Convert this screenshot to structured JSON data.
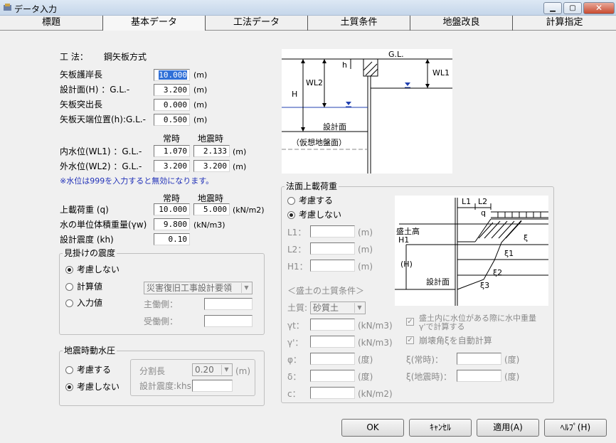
{
  "window": {
    "title": "データ入力"
  },
  "tabs": [
    "標題",
    "基本データ",
    "工法データ",
    "土質条件",
    "地盤改良",
    "計算指定"
  ],
  "method": {
    "label": "工 法：",
    "value": "鋼矢板方式"
  },
  "basic": {
    "rows": [
      {
        "label": "矢板護岸長",
        "value": "10.000",
        "unit": "(m)"
      },
      {
        "label": "設計面(H)  ：G.L.-",
        "value": "3.200",
        "unit": "(m)"
      },
      {
        "label": "矢板突出長",
        "value": "0.000",
        "unit": "(m)"
      },
      {
        "label": "矢板天端位置(h):G.L.-",
        "value": "0.500",
        "unit": "(m)"
      }
    ]
  },
  "water": {
    "col_normal": "常時",
    "col_quake": "地震時",
    "unit": "(m)",
    "inner": {
      "label": "内水位(WL1)  ：G.L.-",
      "normal": "1.070",
      "quake": "2.133"
    },
    "outer": {
      "label": "外水位(WL2)  ：G.L.-",
      "normal": "3.200",
      "quake": "3.200"
    },
    "note": "※水位は999を入力すると無効になります。"
  },
  "load": {
    "col_normal": "常時",
    "col_quake": "地震時",
    "surcharge": {
      "label": "上載荷重 (q)",
      "normal": "10.000",
      "quake": "5.000",
      "unit": "(kN/m2)"
    },
    "unit_weight": {
      "label": "水の単位体積重量(γw)",
      "value": "9.800",
      "unit": "(kN/m3)"
    },
    "seismic": {
      "label": "設計震度 (kh)",
      "value": "0.10"
    }
  },
  "apparent": {
    "title": "見掛けの震度",
    "opt_none": "考慮しない",
    "opt_calc": "計算値",
    "opt_input": "入力値",
    "combo": "災害復旧工事設計要領",
    "main_label": "主働側：",
    "passive_label": "受働側："
  },
  "dynamic": {
    "title": "地震時動水圧",
    "opt_yes": "考慮する",
    "opt_no": "考慮しない",
    "split_label": "分割長",
    "split_value": "0.20",
    "split_unit": "(m)",
    "kh_label": "設計震度:khs"
  },
  "diagram1": {
    "gl": "G.L.",
    "h": "h",
    "wl1": "WL1",
    "wl2": "WL2",
    "H": "H",
    "design": "設計面",
    "virtual": "（仮想地盤面）"
  },
  "slope": {
    "title": "法面上載荷重",
    "opt_yes": "考慮する",
    "opt_no": "考慮しない",
    "L1": "L1：",
    "L2": "L2：",
    "H1": "H1：",
    "unit_m": "(m)",
    "soil_title": "＜盛土の土質条件＞",
    "soil_label": "土質:",
    "soil_value": "砂質土",
    "gt": "γt：",
    "gp": "γ'：",
    "phi": "φ：",
    "delta": "δ：",
    "c": "c：",
    "u_kn3": "(kN/m3)",
    "u_deg": "(度)",
    "u_kn2": "(kN/m2)",
    "chk1": "盛土内に水位がある際に水中重量γ'で計算する",
    "chk2": "崩壊角ξを自動計算",
    "xi_n": "ξ(常時)：",
    "xi_q": "ξ(地震時)："
  },
  "diagram2": {
    "L1": "L1",
    "L2": "L2",
    "q": "q",
    "fill_height": "盛土高",
    "H1": "H1",
    "H": "(H)",
    "design": "設計面",
    "xi": "ξ",
    "xi1": "ξ1",
    "xi2": "ξ2",
    "xi3": "ξ3"
  },
  "buttons": {
    "ok": "OK",
    "cancel": "ｷｬﾝｾﾙ",
    "apply": "適用(A)",
    "help": "ﾍﾙﾌﾟ(H)"
  }
}
